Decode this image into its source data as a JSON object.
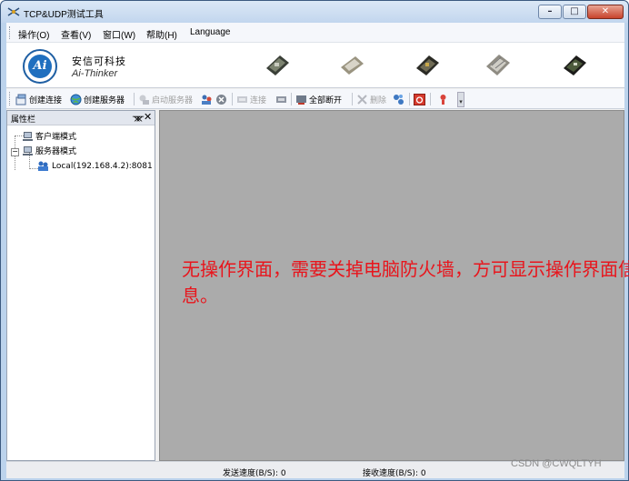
{
  "window": {
    "title": "TCP&UDP测试工具",
    "controls": {
      "minimize": "–",
      "maximize": "□",
      "close": "✕"
    }
  },
  "menu": [
    "操作(O)",
    "查看(V)",
    "窗口(W)",
    "帮助(H)",
    "Language"
  ],
  "banner": {
    "logo": "Ai",
    "company_cn": "安信可科技",
    "company_en": "Ai-Thinker",
    "module_icons": [
      "esp-module-icon",
      "esp-module-icon",
      "esp-module-icon",
      "esp-module-icon",
      "esp-module-icon"
    ]
  },
  "toolbar": {
    "create_connection": "创建连接",
    "create_server": "创建服务器",
    "start_server": "启动服务器",
    "connect": "连接",
    "disconnect_all": "全部断开",
    "delete": "删除"
  },
  "panel": {
    "title": "属性栏",
    "pin": "ᚘ",
    "close": "✕",
    "tree": {
      "client_mode": "客户端模式",
      "server_mode": "服务器模式",
      "server_child": "Local(192.168.4.2):8081",
      "expander_minus": "−"
    }
  },
  "main": {
    "note": "无操作界面，需要关掉电脑防火墙，方可显示操作界面信息。"
  },
  "status": {
    "send_speed": "发送速度(B/S): 0",
    "recv_speed": "接收速度(B/S): 0"
  },
  "watermark": "CSDN @CWQLTYH",
  "colors": {
    "note": "#e8151c",
    "mdi_background": "#ababab",
    "logo_blue": "#1f6fbf"
  }
}
